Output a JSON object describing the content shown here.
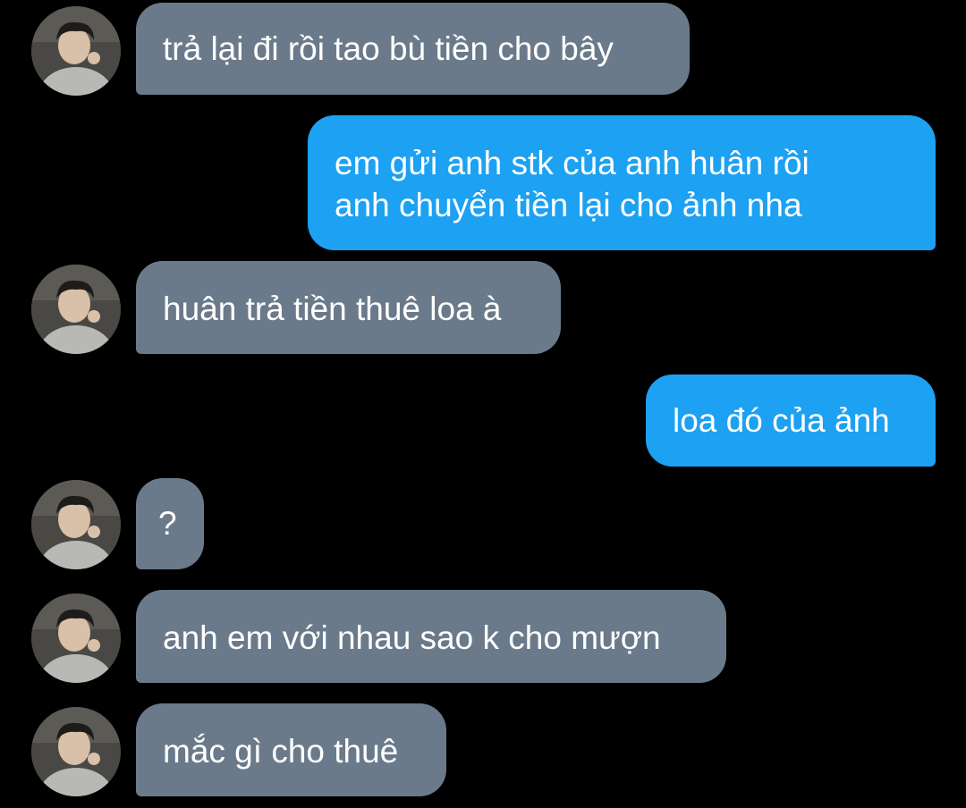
{
  "messages": [
    {
      "direction": "incoming",
      "text": "trả lại đi rồi tao bù tiền cho bây"
    },
    {
      "direction": "outgoing",
      "lines": [
        "em gửi anh stk của anh huân rồi",
        "anh chuyển tiền lại cho ảnh nha"
      ]
    },
    {
      "direction": "incoming",
      "text": "huân trả tiền thuê loa à"
    },
    {
      "direction": "outgoing",
      "text": "loa đó của ảnh"
    },
    {
      "direction": "incoming",
      "text": "?"
    },
    {
      "direction": "incoming",
      "text": "anh em với nhau sao k cho mượn"
    },
    {
      "direction": "incoming",
      "text": "mắc gì cho thuê"
    }
  ],
  "colors": {
    "background": "#000000",
    "incoming_bubble": "#6b7a8a",
    "outgoing_bubble": "#1da1f2",
    "text": "#ffffff"
  },
  "icons": {
    "avatar": "contact-avatar-photo"
  }
}
